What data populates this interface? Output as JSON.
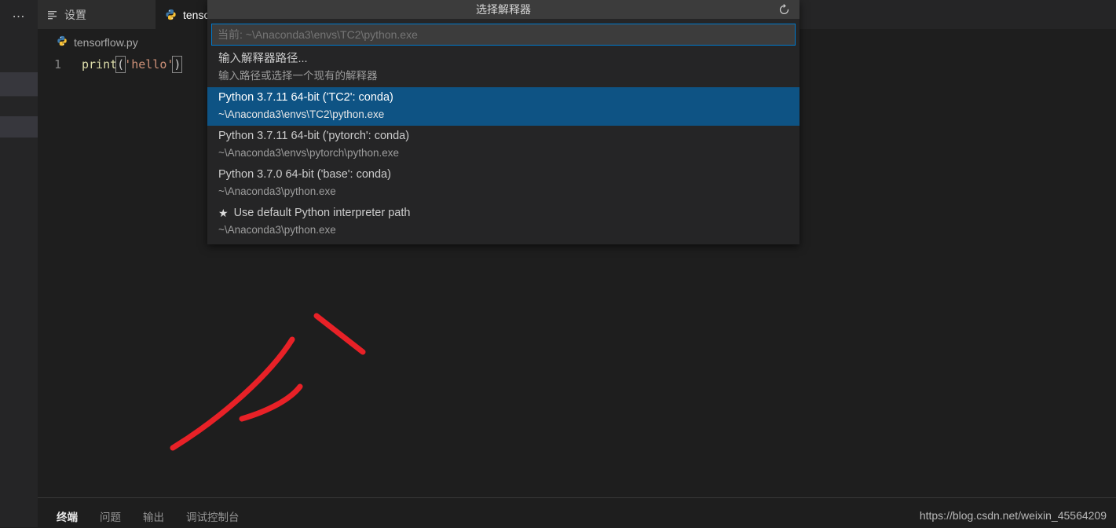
{
  "sidebar": {
    "overflow_label": "…"
  },
  "tabs": [
    {
      "label": "设置",
      "icon": "settings-list-icon",
      "active": false
    },
    {
      "label": "tensorflow.py",
      "icon": "python-icon",
      "active": true
    }
  ],
  "editor": {
    "breadcrumb": "tensorflow.py",
    "breadcrumb_icon": "python-icon",
    "line_number": "1",
    "code": {
      "fn": "print",
      "open_paren": "(",
      "string": "'hello'",
      "close_paren": ")"
    }
  },
  "quickpick": {
    "title": "选择解释器",
    "refresh_icon": "refresh-icon",
    "input_value": "当前: ~\\Anaconda3\\envs\\TC2\\python.exe",
    "input_placeholder": "当前: ~\\Anaconda3\\envs\\TC2\\python.exe",
    "items": [
      {
        "title": "输入解释器路径...",
        "description": "输入路径或选择一个现有的解释器",
        "selected": false,
        "icon": ""
      },
      {
        "title": "Python 3.7.11 64-bit ('TC2': conda)",
        "description": "~\\Anaconda3\\envs\\TC2\\python.exe",
        "selected": true,
        "icon": ""
      },
      {
        "title": "Python 3.7.11 64-bit ('pytorch': conda)",
        "description": "~\\Anaconda3\\envs\\pytorch\\python.exe",
        "selected": false,
        "icon": ""
      },
      {
        "title": "Python 3.7.0 64-bit ('base': conda)",
        "description": "~\\Anaconda3\\python.exe",
        "selected": false,
        "icon": ""
      },
      {
        "title": "Use default Python interpreter path",
        "description": "~\\Anaconda3\\python.exe",
        "selected": false,
        "icon": "★"
      }
    ]
  },
  "panel": {
    "tabs": [
      {
        "label": "终端",
        "active": true
      },
      {
        "label": "问题",
        "active": false
      },
      {
        "label": "输出",
        "active": false
      },
      {
        "label": "调试控制台",
        "active": false
      }
    ]
  },
  "watermark": "https://blog.csdn.net/weixin_45564209",
  "colors": {
    "accent": "#007acc",
    "selection": "#0e5384",
    "editor_bg": "#1e1e1e",
    "chrome_bg": "#252526",
    "annotation_red": "#e82127"
  }
}
